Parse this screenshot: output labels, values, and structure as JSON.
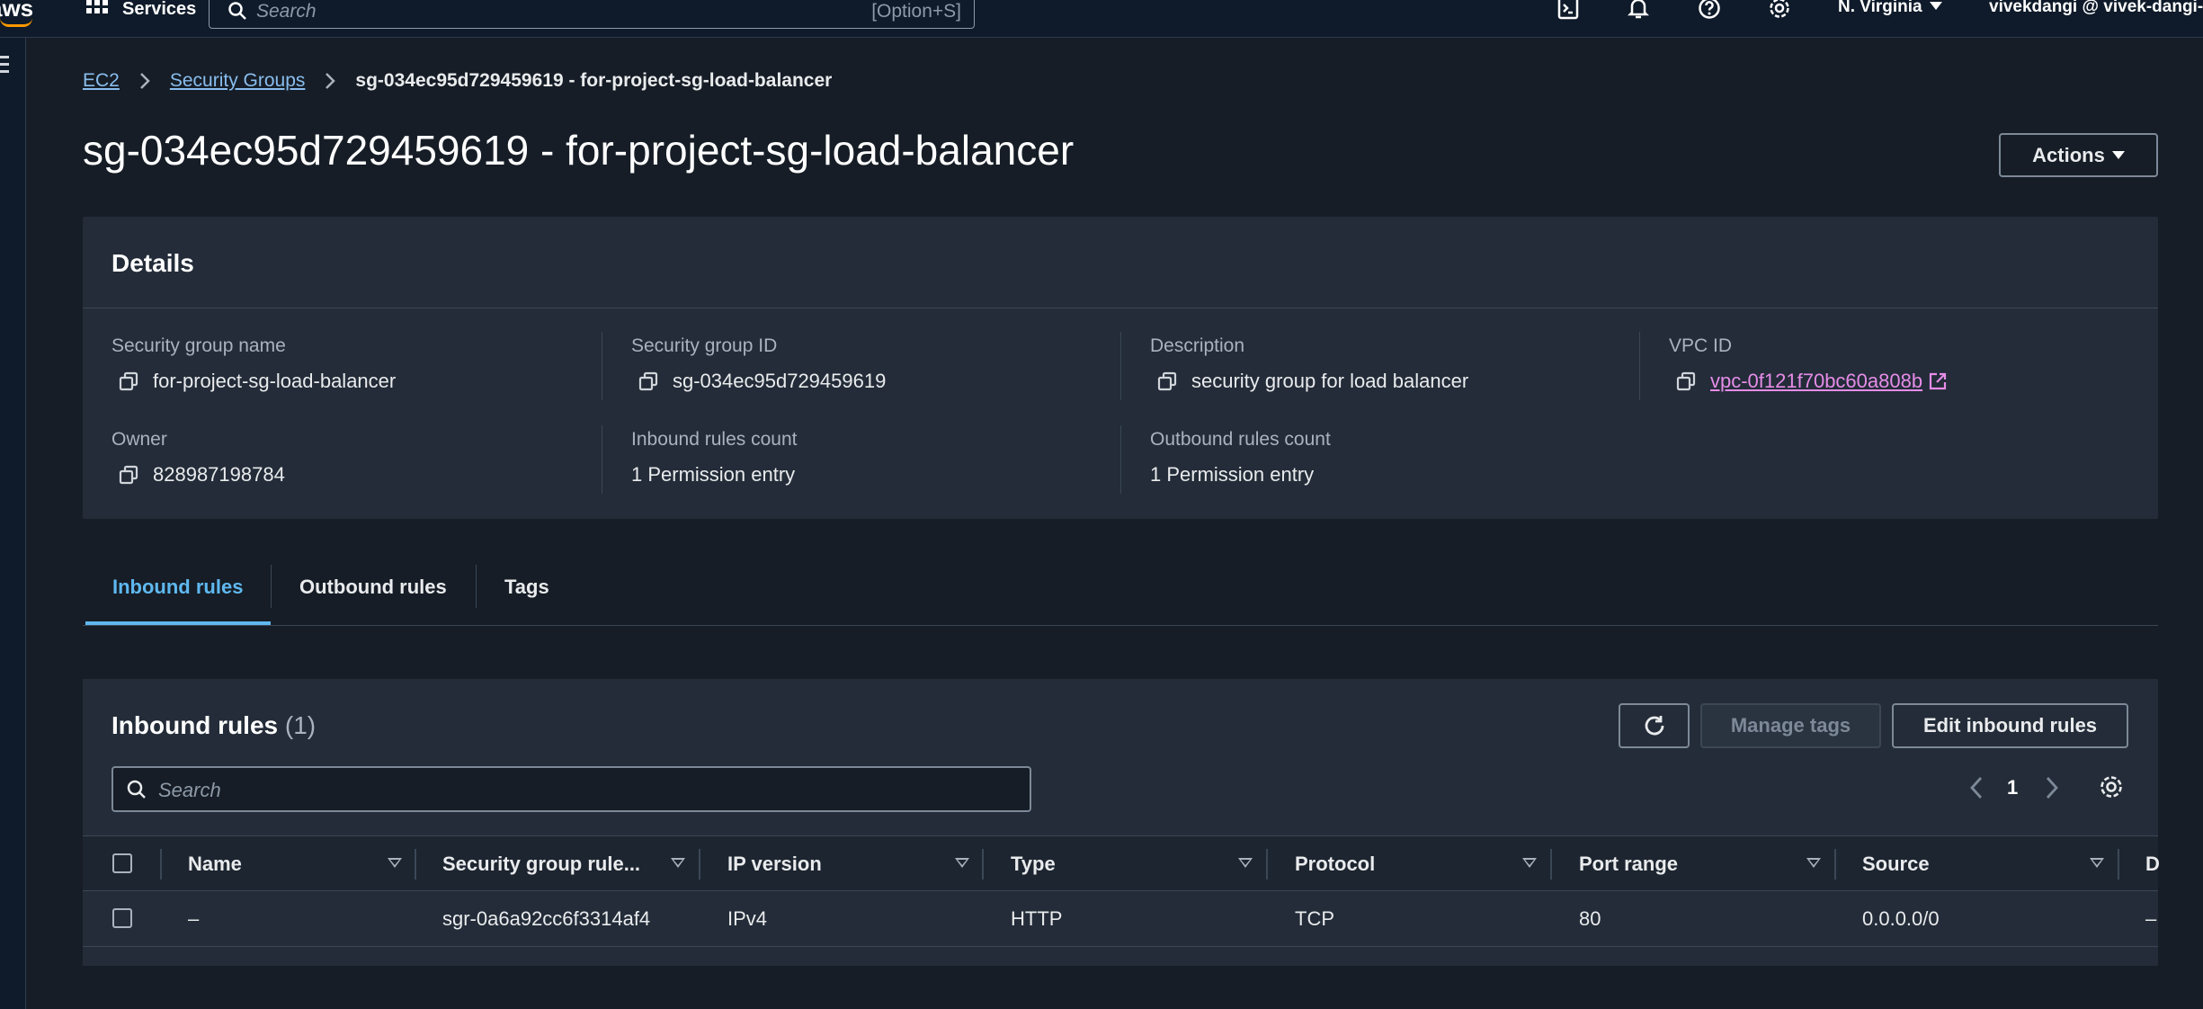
{
  "topnav": {
    "logo": "aws",
    "services_label": "Services",
    "search_placeholder": "Search",
    "search_shortcut": "[Option+S]",
    "region": "N. Virginia",
    "account": "vivekdangi @ vivek-dangi-a",
    "icons": [
      "cloudshell-icon",
      "bell-icon",
      "help-icon",
      "settings-icon"
    ]
  },
  "breadcrumb": {
    "items": [
      "EC2",
      "Security Groups"
    ],
    "current": "sg-034ec95d729459619 - for-project-sg-load-balancer"
  },
  "page": {
    "title": "sg-034ec95d729459619 - for-project-sg-load-balancer",
    "actions_label": "Actions"
  },
  "details": {
    "title": "Details",
    "fields": {
      "sg_name": {
        "label": "Security group name",
        "value": "for-project-sg-load-balancer"
      },
      "sg_id": {
        "label": "Security group ID",
        "value": "sg-034ec95d729459619"
      },
      "description": {
        "label": "Description",
        "value": "security group for load balancer"
      },
      "vpc_id": {
        "label": "VPC ID",
        "value": "vpc-0f121f70bc60a808b"
      },
      "owner": {
        "label": "Owner",
        "value": "828987198784"
      },
      "inbound_count": {
        "label": "Inbound rules count",
        "value": "1 Permission entry"
      },
      "outbound_count": {
        "label": "Outbound rules count",
        "value": "1 Permission entry"
      }
    }
  },
  "tabs": [
    "Inbound rules",
    "Outbound rules",
    "Tags"
  ],
  "inbound": {
    "title": "Inbound rules",
    "count": "(1)",
    "manage_tags_label": "Manage tags",
    "edit_label": "Edit inbound rules",
    "search_placeholder": "Search",
    "page_number": "1",
    "columns": [
      "Name",
      "Security group rule...",
      "IP version",
      "Type",
      "Protocol",
      "Port range",
      "Source",
      "D"
    ],
    "rows": [
      {
        "name": "–",
        "rule_id": "sgr-0a6a92cc6f3314af4",
        "ip_version": "IPv4",
        "type": "HTTP",
        "protocol": "TCP",
        "port_range": "80",
        "source": "0.0.0.0/0",
        "description": "–"
      }
    ]
  },
  "colors": {
    "background": "#161d26",
    "panel": "#232c38",
    "link": "#89bdee",
    "active_tab": "#5fb8f0",
    "vpc_link": "#e68ce8",
    "accent_orange": "#ff9900"
  }
}
